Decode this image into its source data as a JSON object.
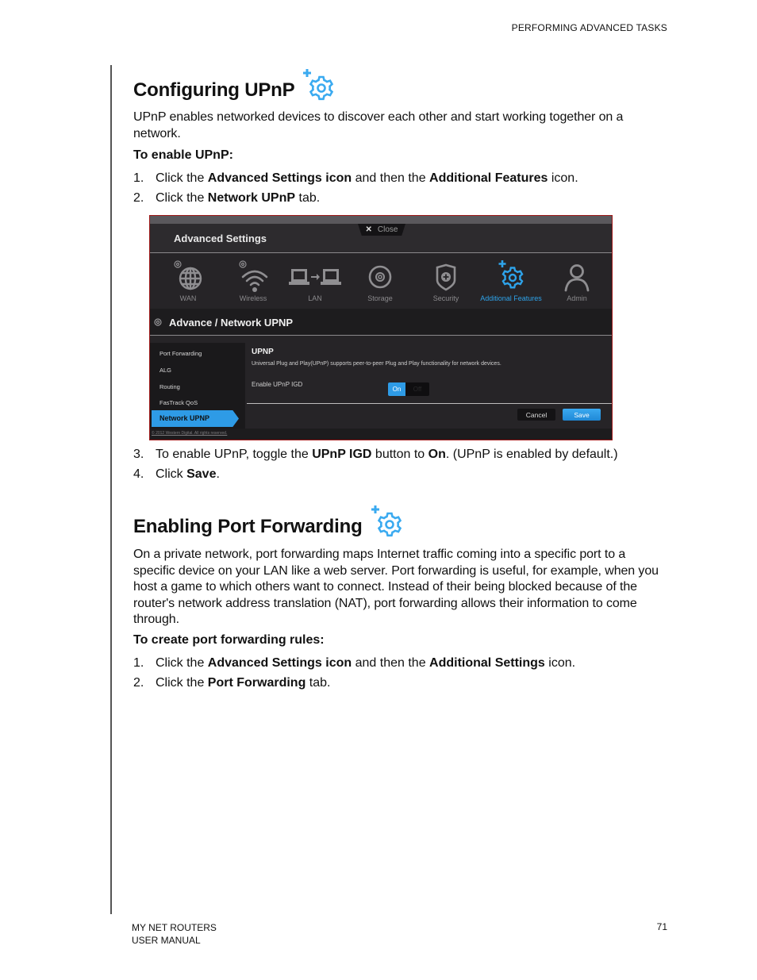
{
  "header": {
    "running_head": "PERFORMING ADVANCED TASKS"
  },
  "section1": {
    "title": "Configuring UPnP",
    "title_icon": "additional-features-gear-icon",
    "intro": "UPnP enables networked devices to discover each other and start working together on a network.",
    "procedure_title": "To enable UPnP:",
    "steps_a": [
      {
        "num": "1.",
        "parts": [
          "Click the ",
          "Advanced Settings icon",
          " and then the ",
          "Additional Features",
          " icon."
        ]
      },
      {
        "num": "2.",
        "parts": [
          "Click the ",
          "Network UPnP",
          " tab."
        ]
      }
    ],
    "steps_b": [
      {
        "num": "3.",
        "parts": [
          "To enable UPnP, toggle the ",
          "UPnP IGD",
          " button to ",
          "On",
          ". (UPnP is enabled by default.)"
        ]
      },
      {
        "num": "4.",
        "parts": [
          "Click ",
          "Save",
          "."
        ]
      }
    ]
  },
  "screenshot": {
    "window_title": "Advanced Settings",
    "close_label": "Close",
    "nav_items": [
      {
        "label": "WAN",
        "icon": "globe-icon",
        "active": false
      },
      {
        "label": "Wireless",
        "icon": "wifi-icon",
        "active": false
      },
      {
        "label": "LAN",
        "icon": "lan-icon",
        "active": false
      },
      {
        "label": "Storage",
        "icon": "storage-disc-icon",
        "active": false
      },
      {
        "label": "Security",
        "icon": "shield-icon",
        "active": false
      },
      {
        "label": "Additional Features",
        "icon": "gear-plus-icon",
        "active": true
      },
      {
        "label": "Admin",
        "icon": "user-icon",
        "active": false
      }
    ],
    "breadcrumb": "Advance / Network UPNP",
    "side_menu": [
      "Port Forwarding",
      "ALG",
      "Routing",
      "FasTrack QoS",
      "Network UPNP"
    ],
    "side_menu_active": "Network UPNP",
    "panel_title": "UPNP",
    "panel_description": "Universal Plug and Play(UPnP) supports peer-to-peer Plug and Play functionality for network devices.",
    "setting_label": "Enable UPnP IGD",
    "toggle_on_label": "On",
    "toggle_off_label": "Off",
    "toggle_state": "On",
    "cancel_label": "Cancel",
    "save_label": "Save",
    "copyright": "© 2012 Western Digital. All rights reserved.",
    "accent_color": "#2e9be6"
  },
  "section2": {
    "title": "Enabling Port Forwarding",
    "title_icon": "additional-features-gear-icon",
    "intro": "On a private network, port forwarding maps Internet traffic coming into a specific port to a specific device on your LAN like a web server. Port forwarding is useful, for example, when you host a game to which others want to connect. Instead of their being blocked because of the router's network address translation (NAT), port forwarding allows their information to come through.",
    "procedure_title": "To create port forwarding rules:",
    "steps": [
      {
        "num": "1.",
        "parts": [
          "Click the ",
          "Advanced Settings icon",
          " and then the ",
          "Additional Settings",
          " icon."
        ]
      },
      {
        "num": "2.",
        "parts": [
          "Click the ",
          "Port Forwarding",
          " tab."
        ]
      }
    ]
  },
  "footer": {
    "product": "MY NET ROUTERS",
    "doc": "USER MANUAL",
    "page_number": "71"
  }
}
